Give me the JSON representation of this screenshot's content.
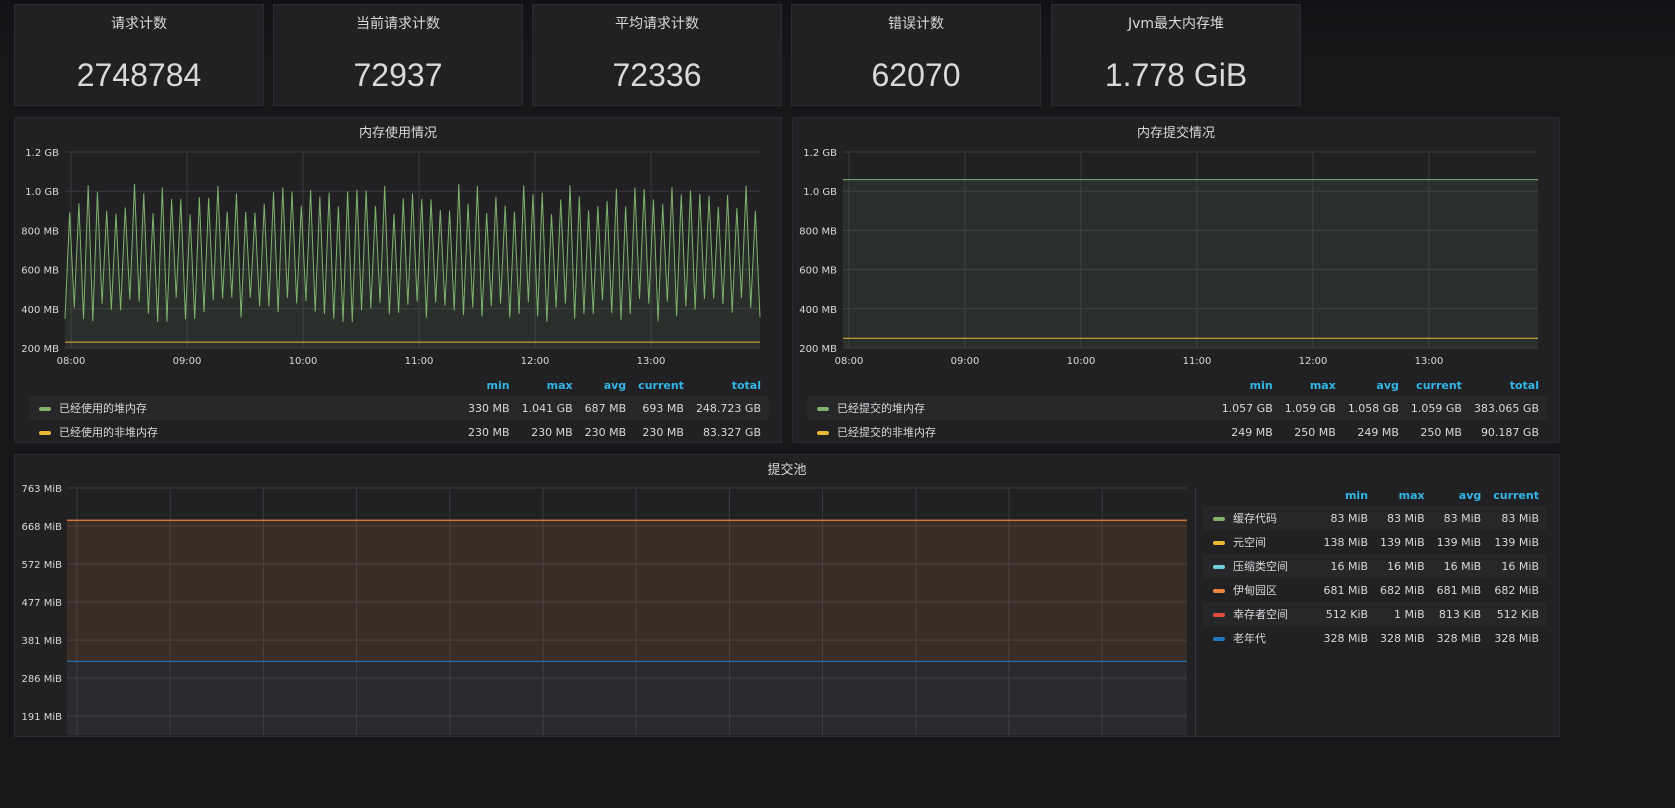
{
  "stats": [
    {
      "title": "请求计数",
      "value": "2748784"
    },
    {
      "title": "当前请求计数",
      "value": "72937"
    },
    {
      "title": "平均请求计数",
      "value": "72336"
    },
    {
      "title": "错误计数",
      "value": "62070"
    },
    {
      "title": "Jvm最大内存堆",
      "value": "1.778 GiB"
    }
  ],
  "legend_headers": {
    "min": "min",
    "max": "max",
    "avg": "avg",
    "current": "current",
    "total": "total"
  },
  "colors": {
    "green": "#7eb26d",
    "yellow": "#eab839",
    "cyan": "#6ed0e0",
    "orange": "#ef843c",
    "red": "#e24d42",
    "blue": "#1f78c1",
    "header": "#33b5e5"
  },
  "chart_data": [
    {
      "type": "line",
      "title": "内存使用情况",
      "y_ticks": [
        "1.2 GB",
        "1.0 GB",
        "800 MB",
        "600 MB",
        "400 MB",
        "200 MB"
      ],
      "ylim": [
        200,
        1200
      ],
      "x_ticks": [
        "08:00",
        "09:00",
        "10:00",
        "11:00",
        "12:00",
        "13:00"
      ],
      "series": [
        {
          "name": "已经使用的堆内存",
          "color": "#7eb26d",
          "pattern": "sawtooth",
          "min_value": 330,
          "max_value": 1041,
          "fill": true,
          "stats": {
            "min": "330 MB",
            "max": "1.041 GB",
            "avg": "687 MB",
            "current": "693 MB",
            "total": "248.723 GB"
          }
        },
        {
          "name": "已经使用的非堆内存",
          "color": "#eab839",
          "values": [
            230,
            230
          ],
          "fill": false,
          "stats": {
            "min": "230 MB",
            "max": "230 MB",
            "avg": "230 MB",
            "current": "230 MB",
            "total": "83.327 GB"
          }
        }
      ]
    },
    {
      "type": "area",
      "title": "内存提交情况",
      "y_ticks": [
        "1.2 GB",
        "1.0 GB",
        "800 MB",
        "600 MB",
        "400 MB",
        "200 MB"
      ],
      "ylim": [
        200,
        1200
      ],
      "x_ticks": [
        "08:00",
        "09:00",
        "10:00",
        "11:00",
        "12:00",
        "13:00"
      ],
      "series": [
        {
          "name": "已经提交的堆内存",
          "color": "#7eb26d",
          "values": [
            1059,
            1059
          ],
          "fill": true,
          "stats": {
            "min": "1.057 GB",
            "max": "1.059 GB",
            "avg": "1.058 GB",
            "current": "1.059 GB",
            "total": "383.065 GB"
          }
        },
        {
          "name": "已经提交的非堆内存",
          "color": "#eab839",
          "values": [
            250,
            250
          ],
          "fill": false,
          "stats": {
            "min": "249 MB",
            "max": "250 MB",
            "avg": "249 MB",
            "current": "250 MB",
            "total": "90.187 GB"
          }
        }
      ]
    },
    {
      "type": "area",
      "title": "提交池",
      "y_ticks": [
        "763 MiB",
        "668 MiB",
        "572 MiB",
        "477 MiB",
        "381 MiB",
        "286 MiB",
        "191 MiB"
      ],
      "ylim": [
        143,
        763
      ],
      "series": [
        {
          "name": "缓存代码",
          "color": "#7eb26d",
          "stats": {
            "min": "83 MiB",
            "max": "83 MiB",
            "avg": "83 MiB",
            "current": "83 MiB"
          }
        },
        {
          "name": "元空间",
          "color": "#eab839",
          "stats": {
            "min": "138 MiB",
            "max": "139 MiB",
            "avg": "139 MiB",
            "current": "139 MiB"
          }
        },
        {
          "name": "压缩类空间",
          "color": "#6ed0e0",
          "stats": {
            "min": "16 MiB",
            "max": "16 MiB",
            "avg": "16 MiB",
            "current": "16 MiB"
          }
        },
        {
          "name": "伊甸园区",
          "color": "#ef843c",
          "stats": {
            "min": "681 MiB",
            "max": "682 MiB",
            "avg": "681 MiB",
            "current": "682 MiB"
          }
        },
        {
          "name": "幸存者空间",
          "color": "#e24d42",
          "stats": {
            "min": "512 KiB",
            "max": "1 MiB",
            "avg": "813 KiB",
            "current": "512 KiB"
          }
        },
        {
          "name": "老年代",
          "color": "#1f78c1",
          "stats": {
            "min": "328 MiB",
            "max": "328 MiB",
            "avg": "328 MiB",
            "current": "328 MiB"
          }
        }
      ],
      "stack_lines": [
        {
          "color": "#ef843c",
          "value": 682
        },
        {
          "color": "#1f78c1",
          "value": 328
        }
      ]
    }
  ]
}
